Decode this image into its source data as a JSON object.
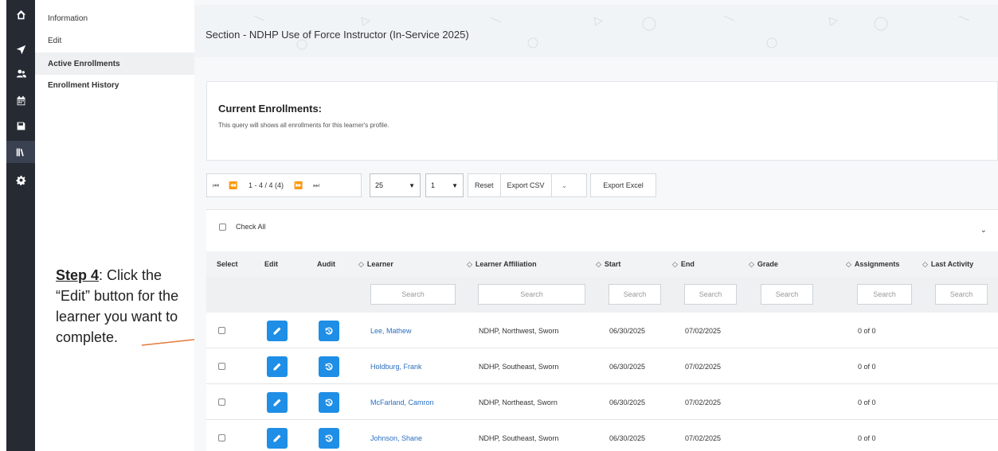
{
  "sidebar": {
    "icons": [
      "home-icon",
      "send-icon",
      "users-icon",
      "calendar-icon",
      "save-icon",
      "library-icon",
      "gear-icon"
    ],
    "menu": [
      {
        "label": "Information"
      },
      {
        "label": "Edit"
      },
      {
        "label": "Active Enrollments"
      },
      {
        "label": "Enrollment History"
      }
    ]
  },
  "annotation": {
    "step_label": "Step 4",
    "text": ": Click the “Edit” button for the learner you want to complete."
  },
  "header": {
    "title": "Section - NDHP Use of Force Instructor (In-Service 2025)"
  },
  "card": {
    "title": "Current Enrollments:",
    "subtitle": "This query will shows all enrollments for this learner's profile."
  },
  "toolbar": {
    "page_info": "1 - 4 / 4 (4)",
    "page_size": "25",
    "page_number": "1",
    "reset_label": "Reset",
    "export_csv_label": "Export CSV",
    "export_excel_label": "Export Excel"
  },
  "table": {
    "check_all_label": "Check All",
    "columns": {
      "select": "Select",
      "edit": "Edit",
      "audit": "Audit",
      "learner": "Learner",
      "affiliation": "Learner Affiliation",
      "start": "Start",
      "end": "End",
      "grade": "Grade",
      "assignments": "Assignments",
      "last_activity": "Last Activity"
    },
    "filter_placeholder": "Search",
    "rows": [
      {
        "learner": "Lee, Mathew",
        "affiliation": "NDHP, Northwest, Sworn",
        "start": "06/30/2025",
        "end": "07/02/2025",
        "grade": "",
        "assignments": "0 of 0",
        "last_activity": ""
      },
      {
        "learner": "Holdburg, Frank",
        "affiliation": "NDHP, Southeast, Sworn",
        "start": "06/30/2025",
        "end": "07/02/2025",
        "grade": "",
        "assignments": "0 of 0",
        "last_activity": ""
      },
      {
        "learner": "McFarland, Camron",
        "affiliation": "NDHP, Northeast, Sworn",
        "start": "06/30/2025",
        "end": "07/02/2025",
        "grade": "",
        "assignments": "0 of 0",
        "last_activity": ""
      },
      {
        "learner": "Johnson, Shane",
        "affiliation": "NDHP, Southeast, Sworn",
        "start": "06/30/2025",
        "end": "07/02/2025",
        "grade": "",
        "assignments": "0 of 0",
        "last_activity": ""
      }
    ]
  },
  "colors": {
    "accent": "#1e8ee6",
    "link": "#2a6fc0",
    "rail": "#252a33",
    "arrow": "#e07a3a"
  }
}
